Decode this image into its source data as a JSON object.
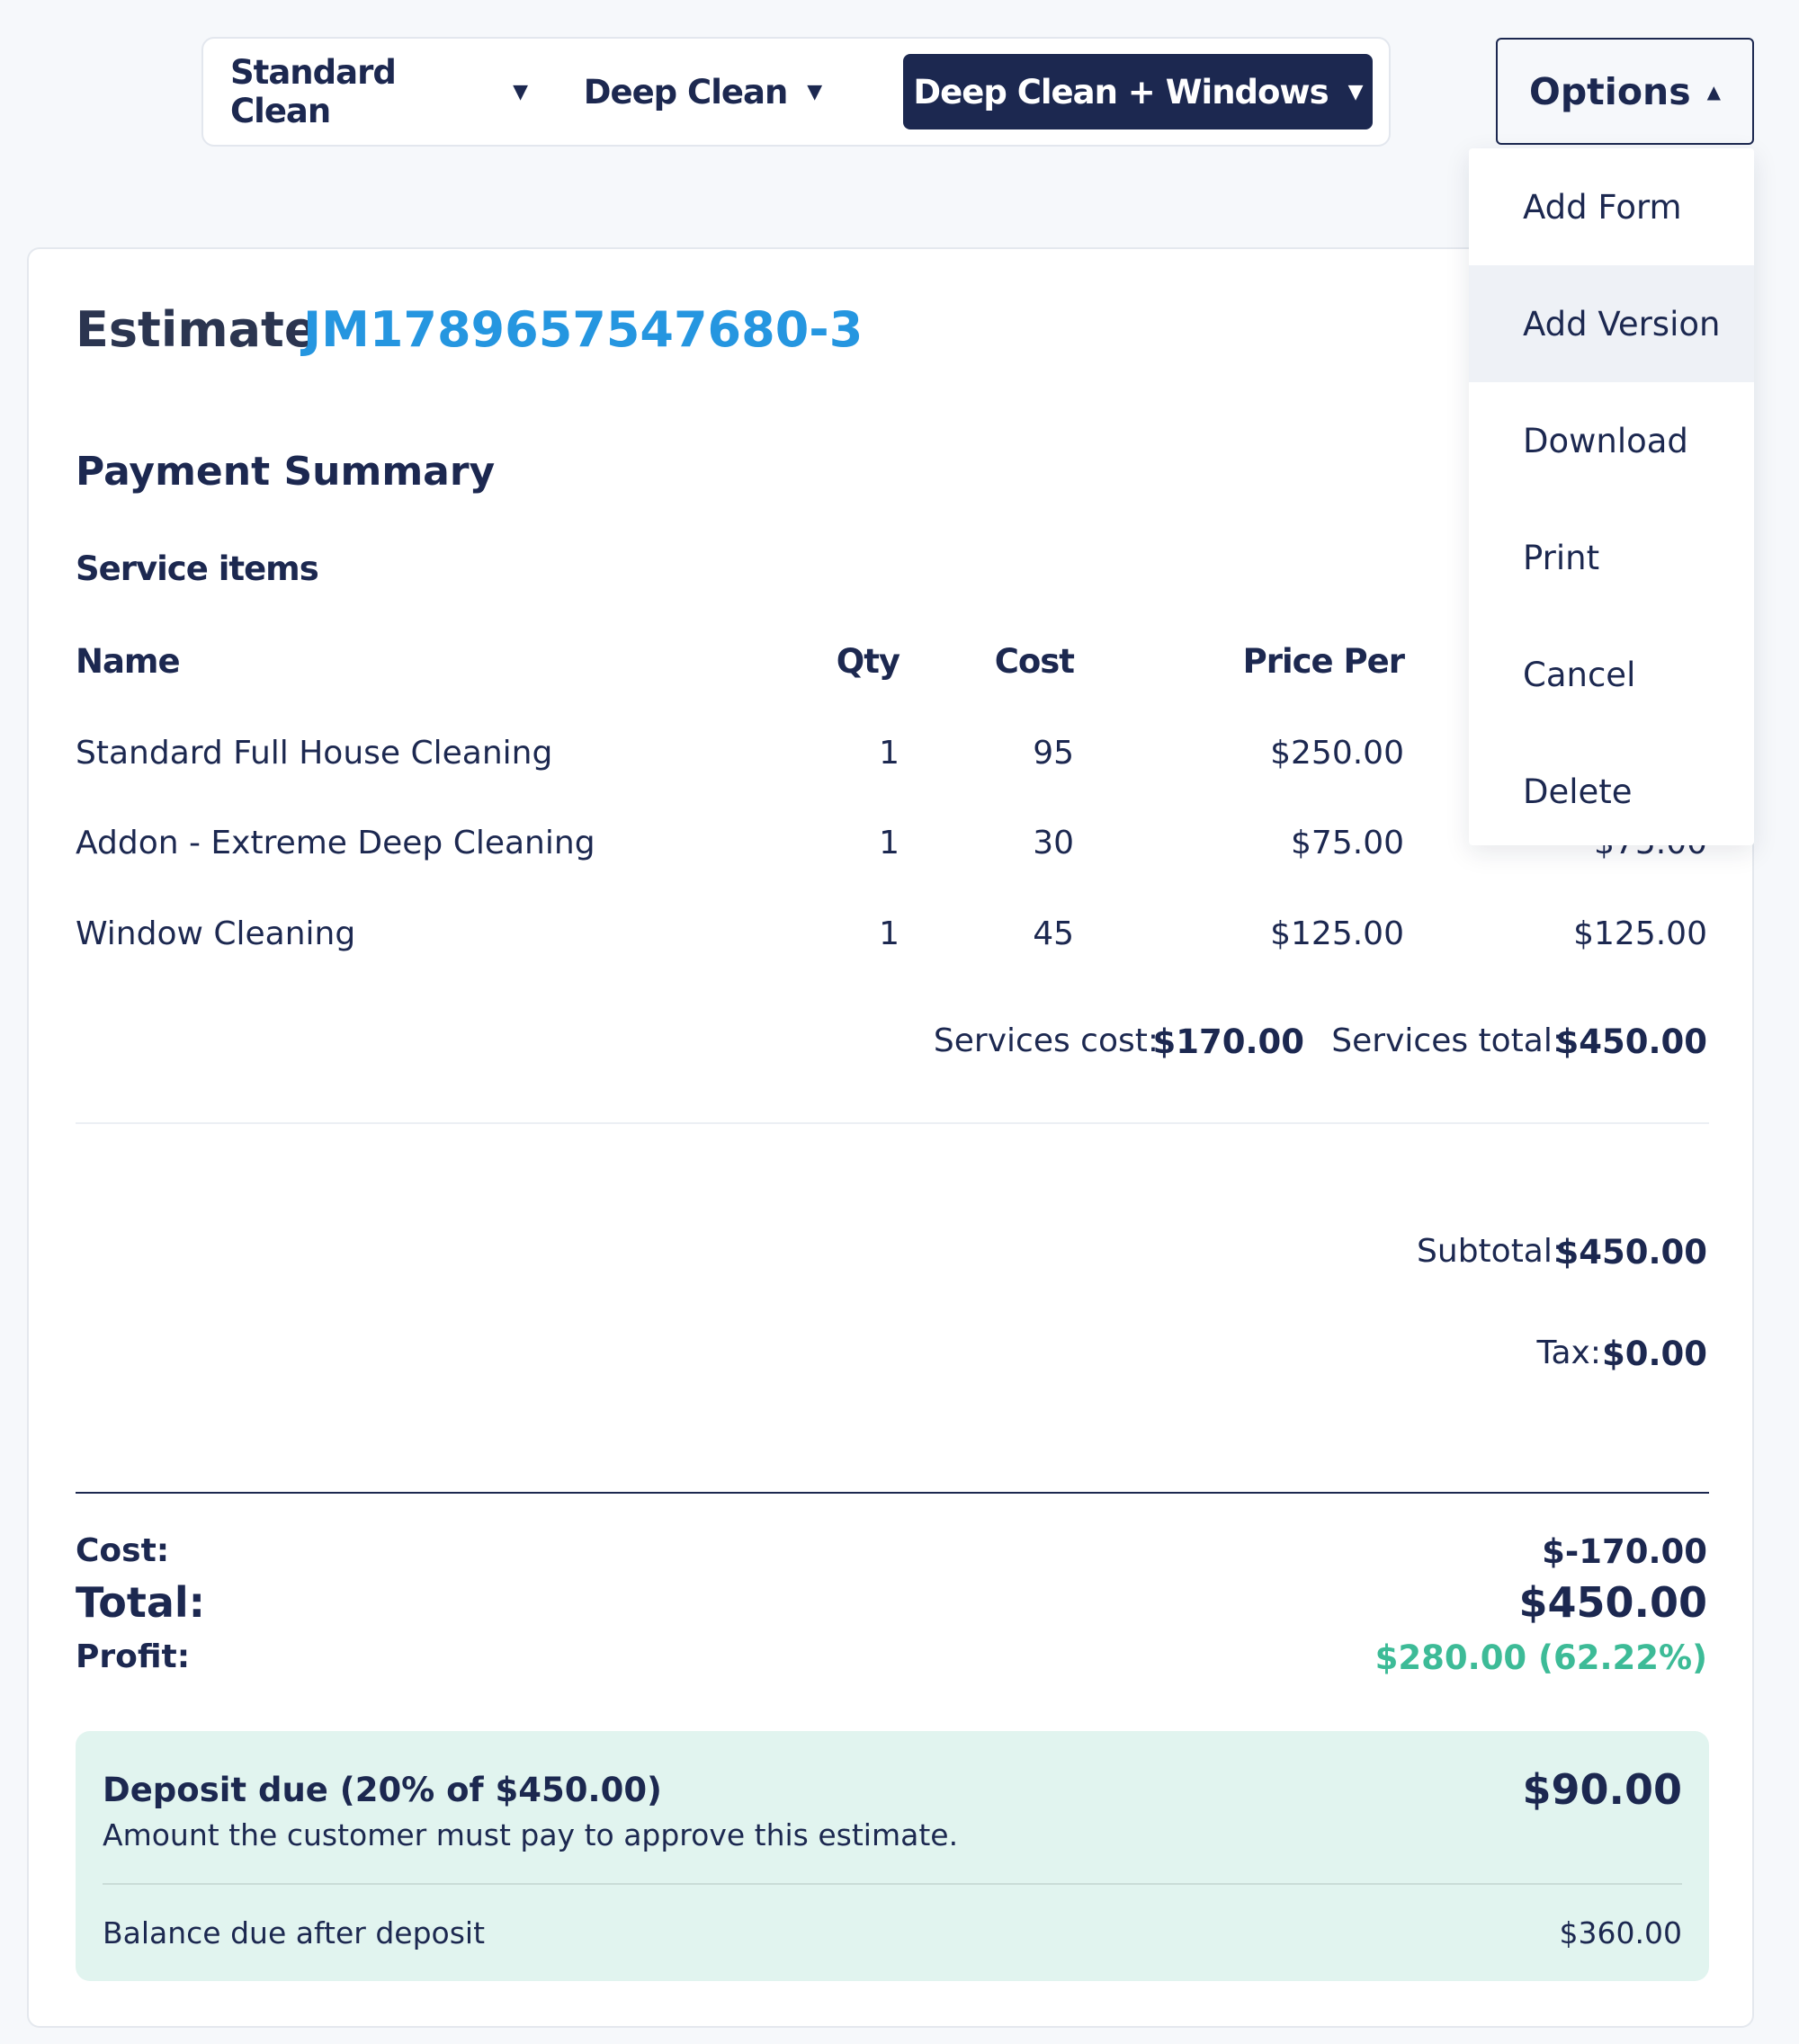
{
  "version_tabs": [
    {
      "label": "Standard Clean",
      "active": false
    },
    {
      "label": "Deep Clean",
      "active": false
    },
    {
      "label": "Deep Clean + Windows",
      "active": true
    }
  ],
  "options": {
    "label": "Options",
    "menu": [
      "Add Form",
      "Add Version",
      "Download",
      "Print",
      "Cancel",
      "Delete"
    ],
    "hovered": "Add Version"
  },
  "estimate": {
    "label": "Estimate",
    "id": "JM1789657547680-3"
  },
  "payment_summary": {
    "heading": "Payment Summary",
    "service_items_heading": "Service items",
    "columns": {
      "name": "Name",
      "qty": "Qty",
      "cost": "Cost",
      "price_per": "Price Per"
    },
    "items": [
      {
        "name": "Standard Full House Cleaning",
        "qty": "1",
        "cost": "95",
        "price_per": "$250.00",
        "total": ""
      },
      {
        "name": "Addon - Extreme Deep Cleaning",
        "qty": "1",
        "cost": "30",
        "price_per": "$75.00",
        "total": "$75.00"
      },
      {
        "name": "Window Cleaning",
        "qty": "1",
        "cost": "45",
        "price_per": "$125.00",
        "total": "$125.00"
      }
    ],
    "services_cost_label": "Services cost:",
    "services_cost_value": "$170.00",
    "services_total_label": "Services total:",
    "services_total_value": "$450.00"
  },
  "totals": {
    "subtotal_label": "Subtotal:",
    "subtotal_value": "$450.00",
    "tax_label": "Tax:",
    "tax_value": "$0.00",
    "cost_label": "Cost:",
    "cost_value": "$-170.00",
    "total_label": "Total:",
    "total_value": "$450.00",
    "profit_label": "Profit:",
    "profit_value": "$280.00 (62.22%)"
  },
  "deposit": {
    "title": "Deposit due (20% of $450.00)",
    "description": "Amount the customer must pay to approve this estimate.",
    "amount": "$90.00",
    "balance_label": "Balance due after deposit",
    "balance_value": "$360.00"
  },
  "colors": {
    "navy": "#1c2850",
    "link_blue": "#2596e0",
    "profit_green": "#3dbb97",
    "deposit_bg": "#e1f4ef"
  }
}
